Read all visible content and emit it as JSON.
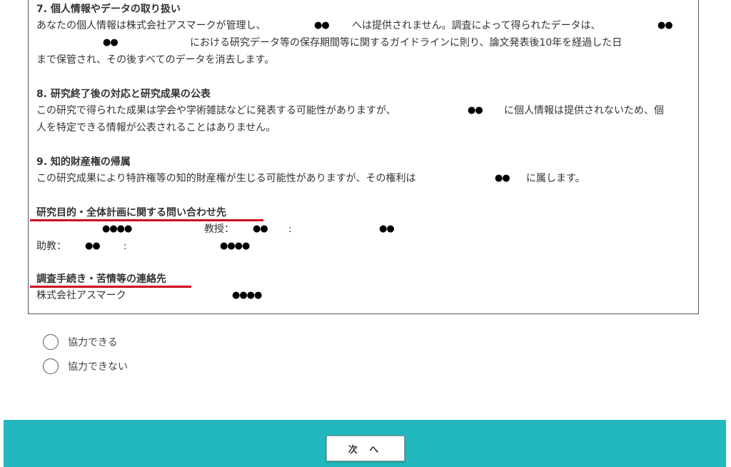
{
  "sections": {
    "s7": {
      "heading": "7. 個人情報やデータの取り扱い",
      "line1a": "あなたの個人情報は株式会社アスマークが管理し、",
      "line1b": "へは提供されません。調査によって得られたデータは、",
      "line2": "における研究データ等の保存期間等に関するガイドラインに則り、論文発表後10年を経過した日",
      "line3": "まで保管され、その後すべてのデータを消去します。"
    },
    "s8": {
      "heading": "8. 研究終了後の対応と研究成果の公表",
      "line1a": "この研究で得られた成果は学会や学術雑誌などに発表する可能性がありますが、",
      "line1b": "に個人情報は提供されないため、個",
      "line2": "人を特定できる情報が公表されることはありません。"
    },
    "s9": {
      "heading": "9. 知的財産権の帰属",
      "line1a": "この研究成果により特許権等の知的財産権が生じる可能性がありますが、その権利は",
      "line1b": "に属します。"
    },
    "contact_research": {
      "heading": "研究目的・全体計画に関する問い合わせ先",
      "professor_label": "教授：",
      "assistant_label": "助教：",
      "colon": ":"
    },
    "contact_procedure": {
      "heading": "調査手続き・苦情等の連絡先",
      "company": "株式会社アスマーク"
    }
  },
  "redactions": {
    "two": "●●",
    "four": "●●●●"
  },
  "options": [
    {
      "label": "協力できる",
      "selected": false
    },
    {
      "label": "協力できない",
      "selected": false
    }
  ],
  "next_button": "次 へ",
  "colors": {
    "footer": "#22b8bd",
    "underline": "#d0021b"
  }
}
